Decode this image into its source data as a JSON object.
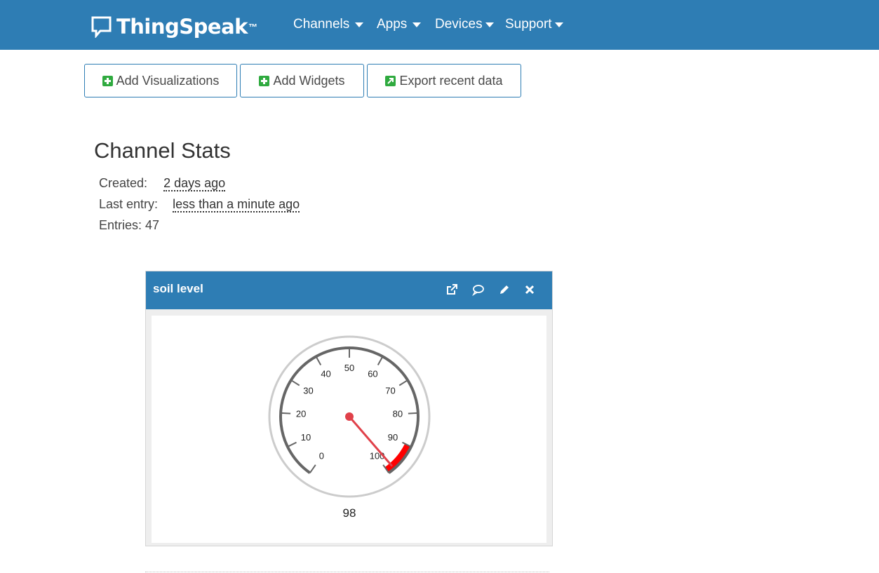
{
  "nav": {
    "brand": "ThingSpeak",
    "brand_tm": "™",
    "items": [
      {
        "label": "Channels"
      },
      {
        "label": "Apps"
      },
      {
        "label": "Devices"
      },
      {
        "label": "Support"
      }
    ]
  },
  "toolbar": {
    "add_visualizations": "Add Visualizations",
    "add_widgets": "Add Widgets",
    "export_recent": "Export recent data"
  },
  "stats": {
    "title": "Channel Stats",
    "created_label": "Created:",
    "created_value": "2 days ago",
    "last_entry_label": "Last entry:",
    "last_entry_value": "less than a minute ago",
    "entries_label": "Entries: 47"
  },
  "widget": {
    "title": "soil level",
    "icons": [
      "external-link-icon",
      "comment-icon",
      "pencil-icon",
      "close-icon"
    ]
  },
  "gauge": {
    "min": 0,
    "max": 100,
    "value": 98,
    "value_text": "98",
    "ticks": [
      "0",
      "10",
      "20",
      "30",
      "40",
      "50",
      "60",
      "70",
      "80",
      "90",
      "100"
    ],
    "red_band": [
      90,
      100
    ],
    "colors": {
      "rim": "#cccccc",
      "arc": "#666666",
      "needle": "#e0414a",
      "band": "#ff0000"
    }
  },
  "colors": {
    "header": "#2e7db4",
    "accent_green": "#2faa3f"
  }
}
